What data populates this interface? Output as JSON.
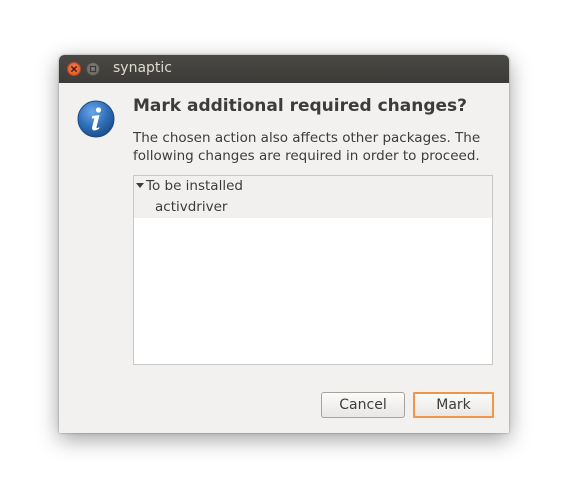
{
  "window": {
    "title": "synaptic"
  },
  "dialog": {
    "icon": "info-icon",
    "heading": "Mark additional required changes?",
    "message_line1": "The chosen action also affects other packages. The",
    "message_line2": "following changes are required in order to proceed."
  },
  "changes_tree": {
    "groups": [
      {
        "label": "To be installed",
        "expanded": true,
        "items": [
          "activdriver"
        ]
      }
    ]
  },
  "buttons": {
    "cancel_label": "Cancel",
    "mark_label": "Mark"
  },
  "colors": {
    "titlebar": "#3c3b37",
    "close_button": "#e2541f",
    "focus_accent": "#f0954a",
    "info_icon": "#2f6fb8"
  }
}
